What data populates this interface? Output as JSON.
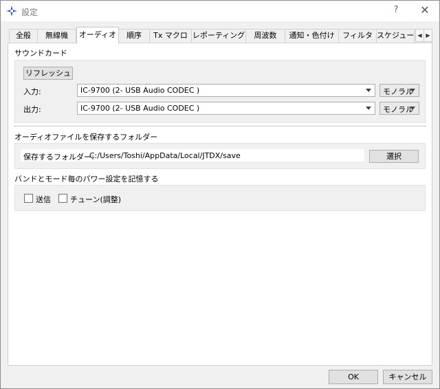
{
  "window": {
    "title": "設定",
    "help_label": "?",
    "close_label": "✕"
  },
  "tabs": [
    {
      "label": "全般"
    },
    {
      "label": "無線機"
    },
    {
      "label": "オーディオ",
      "active": true
    },
    {
      "label": "順序"
    },
    {
      "label": "Tx マクロ"
    },
    {
      "label": "レポーティング"
    },
    {
      "label": "周波数"
    },
    {
      "label": "通知・色付け"
    },
    {
      "label": "フィルタ"
    },
    {
      "label": "スケジュー"
    }
  ],
  "tab_scroll": {
    "left": "◀",
    "right": "▶"
  },
  "soundcard": {
    "title": "サウンドカード",
    "refresh_label": "リフレッシュ",
    "input_label": "入力:",
    "input_device": "IC-9700 (2- USB Audio CODEC )",
    "input_channel": "モノラル",
    "output_label": "出力:",
    "output_device": "IC-9700 (2- USB Audio CODEC )",
    "output_channel": "モノラル"
  },
  "save_folder": {
    "title": "オーディオファイルを保存するフォルダー",
    "label": "保存するフォルダー:",
    "path": "C:/Users/Toshi/AppData/Local/JTDX/save",
    "select_label": "選択"
  },
  "power_memory": {
    "title": "バンドとモード毎のパワー設定を記憶する",
    "transmit_label": "送信",
    "tune_label": "チューン(調整)"
  },
  "footer": {
    "ok_label": "OK",
    "cancel_label": "キャンセル"
  }
}
